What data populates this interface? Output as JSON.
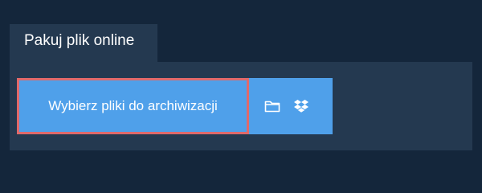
{
  "tab": {
    "label": "Pakuj plik online"
  },
  "upload": {
    "choose_label": "Wybierz pliki do archiwizacji",
    "icons": [
      "folder-icon",
      "dropbox-icon"
    ]
  },
  "colors": {
    "background": "#14263b",
    "panel": "#243950",
    "button": "#4fa0ea",
    "highlight_border": "#e0696a"
  }
}
